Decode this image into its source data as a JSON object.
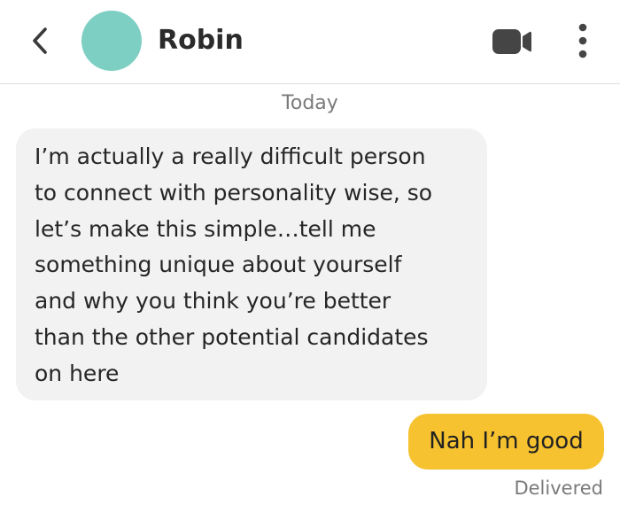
{
  "header": {
    "contact_name": "Robin",
    "avatar_color": "#7ecfc3",
    "back_icon": "chevron-left-icon",
    "video_icon": "video-camera-icon",
    "menu_icon": "more-vertical-icon"
  },
  "conversation": {
    "date_separator": "Today",
    "messages": [
      {
        "direction": "incoming",
        "bubble_color": "#f2f2f2",
        "lines": [
          "I’m actually a really difficult person",
          "to connect with personality wise, so",
          "let’s make this simple…tell me",
          "something unique about yourself",
          "and why you think you’re better",
          "than the other potential candidates",
          "on here"
        ]
      },
      {
        "direction": "outgoing",
        "bubble_color": "#f6c22f",
        "text": "Nah I’m good",
        "status": "Delivered"
      }
    ]
  }
}
